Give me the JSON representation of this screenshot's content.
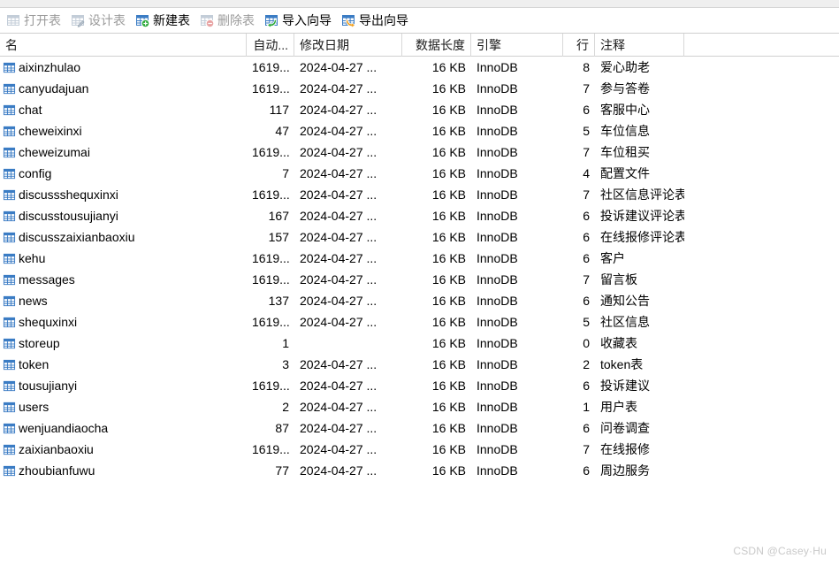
{
  "toolbar": {
    "buttons": [
      {
        "label": "打开表",
        "icon": "open-table-icon",
        "enabled": false
      },
      {
        "label": "设计表",
        "icon": "design-table-icon",
        "enabled": false
      },
      {
        "label": "新建表",
        "icon": "new-table-icon",
        "enabled": true
      },
      {
        "label": "删除表",
        "icon": "delete-table-icon",
        "enabled": false
      },
      {
        "label": "导入向导",
        "icon": "import-wizard-icon",
        "enabled": true
      },
      {
        "label": "导出向导",
        "icon": "export-wizard-icon",
        "enabled": true
      }
    ]
  },
  "grid": {
    "columns": [
      {
        "key": "name",
        "label": "名"
      },
      {
        "key": "auto",
        "label": "自动..."
      },
      {
        "key": "date",
        "label": "修改日期"
      },
      {
        "key": "length",
        "label": "数据长度"
      },
      {
        "key": "engine",
        "label": "引擎"
      },
      {
        "key": "rows",
        "label": "行"
      },
      {
        "key": "comment",
        "label": "注释"
      },
      {
        "key": "tail",
        "label": ""
      }
    ],
    "rows": [
      {
        "icon": "table-icon",
        "name": "aixinzhulao",
        "auto": "1619...",
        "date": "2024-04-27 ...",
        "length": "16 KB",
        "engine": "InnoDB",
        "rows": "8",
        "comment": "爱心助老"
      },
      {
        "icon": "table-icon",
        "name": "canyudajuan",
        "auto": "1619...",
        "date": "2024-04-27 ...",
        "length": "16 KB",
        "engine": "InnoDB",
        "rows": "7",
        "comment": "参与答卷"
      },
      {
        "icon": "table-icon",
        "name": "chat",
        "auto": "117",
        "date": "2024-04-27 ...",
        "length": "16 KB",
        "engine": "InnoDB",
        "rows": "6",
        "comment": "客服中心"
      },
      {
        "icon": "table-icon",
        "name": "cheweixinxi",
        "auto": "47",
        "date": "2024-04-27 ...",
        "length": "16 KB",
        "engine": "InnoDB",
        "rows": "5",
        "comment": "车位信息"
      },
      {
        "icon": "table-icon",
        "name": "cheweizumai",
        "auto": "1619...",
        "date": "2024-04-27 ...",
        "length": "16 KB",
        "engine": "InnoDB",
        "rows": "7",
        "comment": "车位租买"
      },
      {
        "icon": "table-icon",
        "name": "config",
        "auto": "7",
        "date": "2024-04-27 ...",
        "length": "16 KB",
        "engine": "InnoDB",
        "rows": "4",
        "comment": "配置文件"
      },
      {
        "icon": "table-icon",
        "name": "discussshequxinxi",
        "auto": "1619...",
        "date": "2024-04-27 ...",
        "length": "16 KB",
        "engine": "InnoDB",
        "rows": "7",
        "comment": "社区信息评论表"
      },
      {
        "icon": "table-icon",
        "name": "discusstousujianyi",
        "auto": "167",
        "date": "2024-04-27 ...",
        "length": "16 KB",
        "engine": "InnoDB",
        "rows": "6",
        "comment": "投诉建议评论表"
      },
      {
        "icon": "table-icon",
        "name": "discusszaixianbaoxiu",
        "auto": "157",
        "date": "2024-04-27 ...",
        "length": "16 KB",
        "engine": "InnoDB",
        "rows": "6",
        "comment": "在线报修评论表"
      },
      {
        "icon": "table-icon",
        "name": "kehu",
        "auto": "1619...",
        "date": "2024-04-27 ...",
        "length": "16 KB",
        "engine": "InnoDB",
        "rows": "6",
        "comment": "客户"
      },
      {
        "icon": "table-icon",
        "name": "messages",
        "auto": "1619...",
        "date": "2024-04-27 ...",
        "length": "16 KB",
        "engine": "InnoDB",
        "rows": "7",
        "comment": "留言板"
      },
      {
        "icon": "table-icon",
        "name": "news",
        "auto": "137",
        "date": "2024-04-27 ...",
        "length": "16 KB",
        "engine": "InnoDB",
        "rows": "6",
        "comment": "通知公告"
      },
      {
        "icon": "table-icon",
        "name": "shequxinxi",
        "auto": "1619...",
        "date": "2024-04-27 ...",
        "length": "16 KB",
        "engine": "InnoDB",
        "rows": "5",
        "comment": "社区信息"
      },
      {
        "icon": "table-icon",
        "name": "storeup",
        "auto": "1",
        "date": "",
        "length": "16 KB",
        "engine": "InnoDB",
        "rows": "0",
        "comment": "收藏表"
      },
      {
        "icon": "table-icon",
        "name": "token",
        "auto": "3",
        "date": "2024-04-27 ...",
        "length": "16 KB",
        "engine": "InnoDB",
        "rows": "2",
        "comment": "token表"
      },
      {
        "icon": "table-icon",
        "name": "tousujianyi",
        "auto": "1619...",
        "date": "2024-04-27 ...",
        "length": "16 KB",
        "engine": "InnoDB",
        "rows": "6",
        "comment": "投诉建议"
      },
      {
        "icon": "table-icon",
        "name": "users",
        "auto": "2",
        "date": "2024-04-27 ...",
        "length": "16 KB",
        "engine": "InnoDB",
        "rows": "1",
        "comment": "用户表"
      },
      {
        "icon": "table-icon",
        "name": "wenjuandiaocha",
        "auto": "87",
        "date": "2024-04-27 ...",
        "length": "16 KB",
        "engine": "InnoDB",
        "rows": "6",
        "comment": "问卷调查"
      },
      {
        "icon": "table-icon",
        "name": "zaixianbaoxiu",
        "auto": "1619...",
        "date": "2024-04-27 ...",
        "length": "16 KB",
        "engine": "InnoDB",
        "rows": "7",
        "comment": "在线报修"
      },
      {
        "icon": "table-icon",
        "name": "zhoubianfuwu",
        "auto": "77",
        "date": "2024-04-27 ...",
        "length": "16 KB",
        "engine": "InnoDB",
        "rows": "6",
        "comment": "周边服务"
      }
    ]
  },
  "watermark": {
    "text": "CSDN @Casey·Hu"
  },
  "colors": {
    "table_icon_blue": "#3b7cc4",
    "table_icon_fill": "#ffffff",
    "toolbar_disabled": "#9b9b9b",
    "grid_line": "#d8d8d8",
    "strip_bg": "#efefef"
  }
}
